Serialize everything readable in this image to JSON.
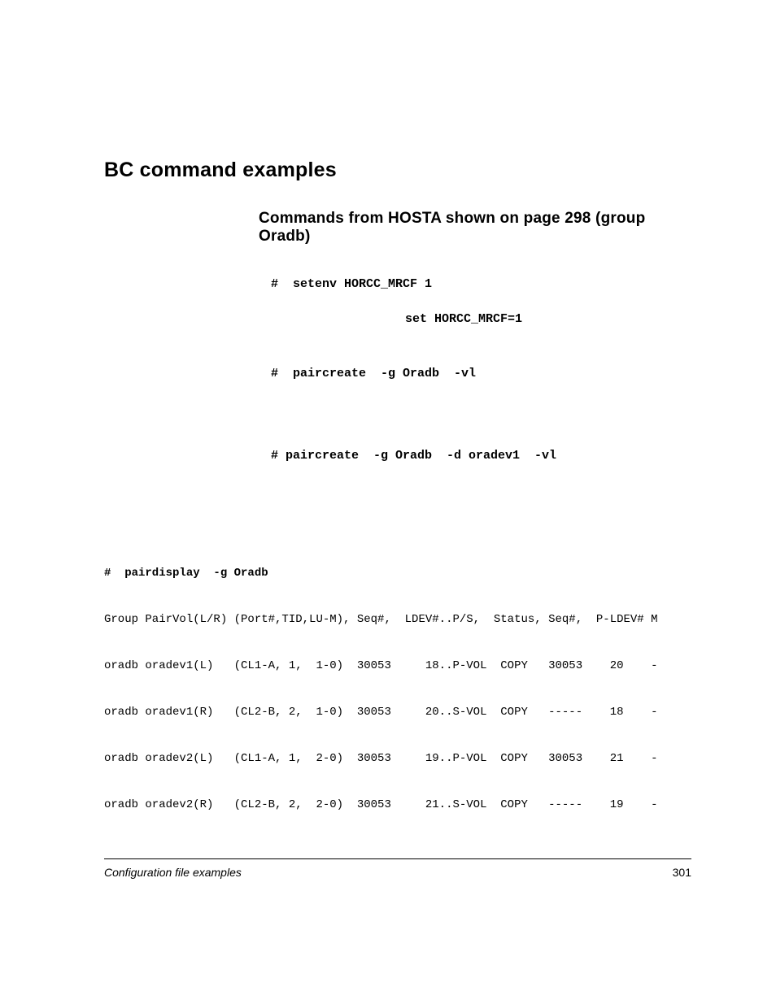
{
  "headings": {
    "h1": "BC command examples",
    "h2": "Commands from HOSTA shown on page 298 (group Oradb)"
  },
  "commands": {
    "setenv_prefix": "#  setenv HORCC_MRCF 1",
    "set_line": "set HORCC_MRCF=1",
    "paircreate1": "#  paircreate  -g Oradb  -vl",
    "paircreate2": "# paircreate  -g Oradb  -d oradev1  -vl",
    "pairdisplay": "#  pairdisplay  -g Oradb"
  },
  "table": {
    "header": "Group PairVol(L/R) (Port#,TID,LU-M), Seq#,  LDEV#..P/S,  Status, Seq#,  P-LDEV# M",
    "rows": [
      "oradb oradev1(L)   (CL1-A, 1,  1-0)  30053     18..P-VOL  COPY   30053    20    -",
      "oradb oradev1(R)   (CL2-B, 2,  1-0)  30053     20..S-VOL  COPY   -----    18    -",
      "oradb oradev2(L)   (CL1-A, 1,  2-0)  30053     19..P-VOL  COPY   30053    21    -",
      "oradb oradev2(R)   (CL2-B, 2,  2-0)  30053     21..S-VOL  COPY   -----    19    -"
    ]
  },
  "footer": {
    "left": "Configuration file examples",
    "right": "301"
  }
}
